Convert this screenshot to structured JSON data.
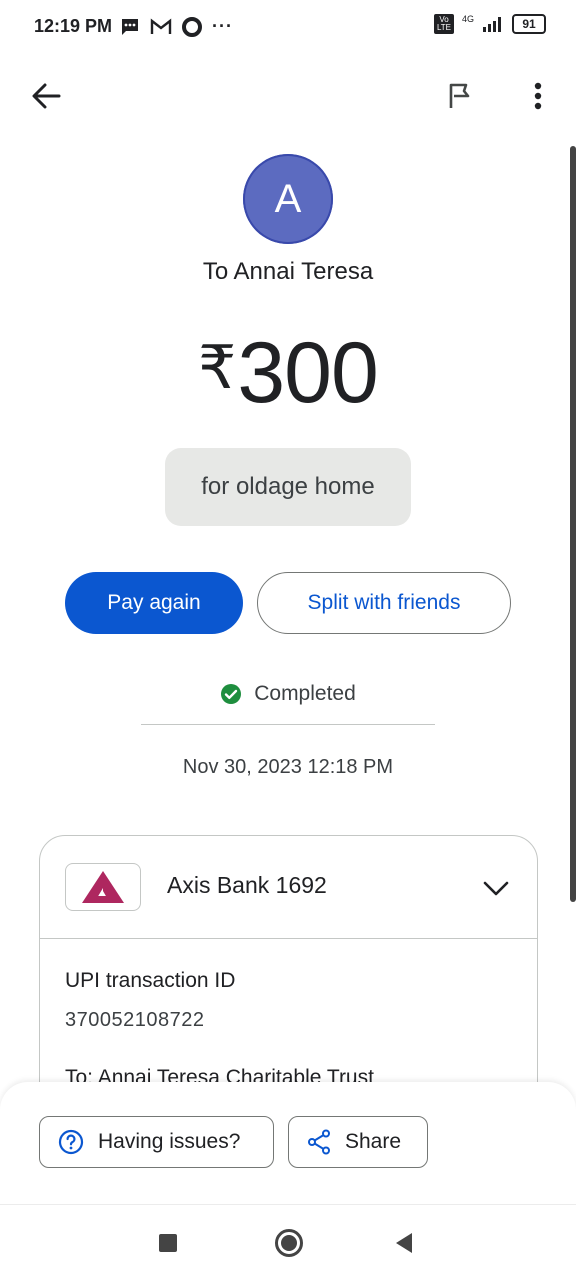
{
  "status_bar": {
    "time": "12:19 PM",
    "network": "4G",
    "volte": "Vo LTE",
    "battery": "91"
  },
  "app_bar": {
    "back_icon": "arrow-left-icon",
    "report_icon": "flag-icon",
    "more_icon": "more-vert-icon"
  },
  "payment": {
    "avatar_letter": "A",
    "recipient": "To Annai Teresa",
    "currency": "₹",
    "amount": "300",
    "note": "for oldage home",
    "status": "Completed",
    "datetime": "Nov 30, 2023 12:18 PM"
  },
  "actions": {
    "pay_again": "Pay again",
    "split": "Split with friends"
  },
  "details": {
    "bank_name": "Axis Bank 1692",
    "upi_label": "UPI transaction ID",
    "upi_id": "370052108722",
    "to_line": "To: Annai Teresa Charitable Trust"
  },
  "bottom_actions": {
    "issues": "Having issues?",
    "share": "Share"
  },
  "colors": {
    "primary": "#0b57d0",
    "avatar": "#5c6bc0",
    "success": "#1e8e3e",
    "axis_red": "#ae275f"
  }
}
